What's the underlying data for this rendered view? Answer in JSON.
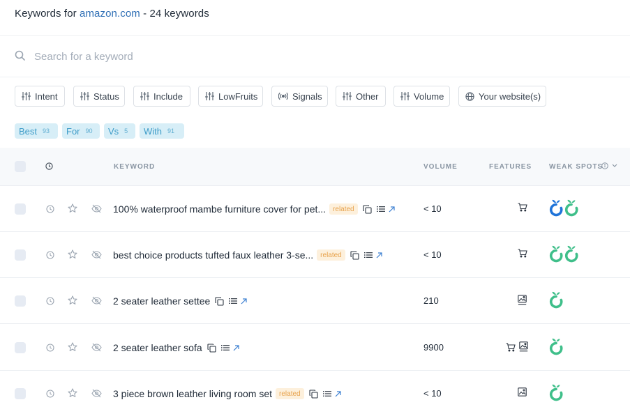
{
  "header": {
    "prefix": "Keywords for",
    "domain": "amazon.com",
    "suffix": "- 24 keywords"
  },
  "search": {
    "placeholder": "Search for a keyword",
    "value": ""
  },
  "filters": [
    "Intent",
    "Status",
    "Include",
    "LowFruits",
    "Signals",
    "Other",
    "Volume",
    "Your website(s)"
  ],
  "tags": [
    {
      "label": "Best",
      "count": "93"
    },
    {
      "label": "For",
      "count": "90"
    },
    {
      "label": "Vs",
      "count": "5"
    },
    {
      "label": "With",
      "count": "91"
    }
  ],
  "table": {
    "headers": {
      "keyword": "KEYWORD",
      "volume": "VOLUME",
      "features": "FEATURES",
      "weak_spots": "WEAK SPOTS"
    },
    "rows": [
      {
        "keyword": "100% waterproof mambe furniture cover for pet...",
        "badge": "related",
        "volume": "< 10",
        "features": [
          "cart-icon"
        ],
        "weak_spots": [
          "blue",
          "green"
        ]
      },
      {
        "keyword": "best choice products tufted faux leather 3-se...",
        "badge": "related",
        "volume": "< 10",
        "features": [
          "cart-icon"
        ],
        "weak_spots": [
          "green",
          "green"
        ]
      },
      {
        "keyword": "2 seater leather settee",
        "badge": "",
        "volume": "210",
        "features": [
          "image-icon"
        ],
        "weak_spots": [
          "green"
        ]
      },
      {
        "keyword": "2 seater leather sofa",
        "badge": "",
        "volume": "9900",
        "features": [
          "cart-icon",
          "image-icon"
        ],
        "weak_spots": [
          "green"
        ]
      },
      {
        "keyword": "3 piece brown leather living room set",
        "badge": "related",
        "volume": "< 10",
        "features": [
          "image-icon"
        ],
        "weak_spots": [
          "green"
        ]
      }
    ]
  },
  "colors": {
    "accent_blue": "#2f6fb5",
    "spot_green": "#3fbf8a",
    "spot_blue": "#1f74d9",
    "tag_bg": "#d7eef7",
    "badge_bg": "#fdf0dc"
  }
}
